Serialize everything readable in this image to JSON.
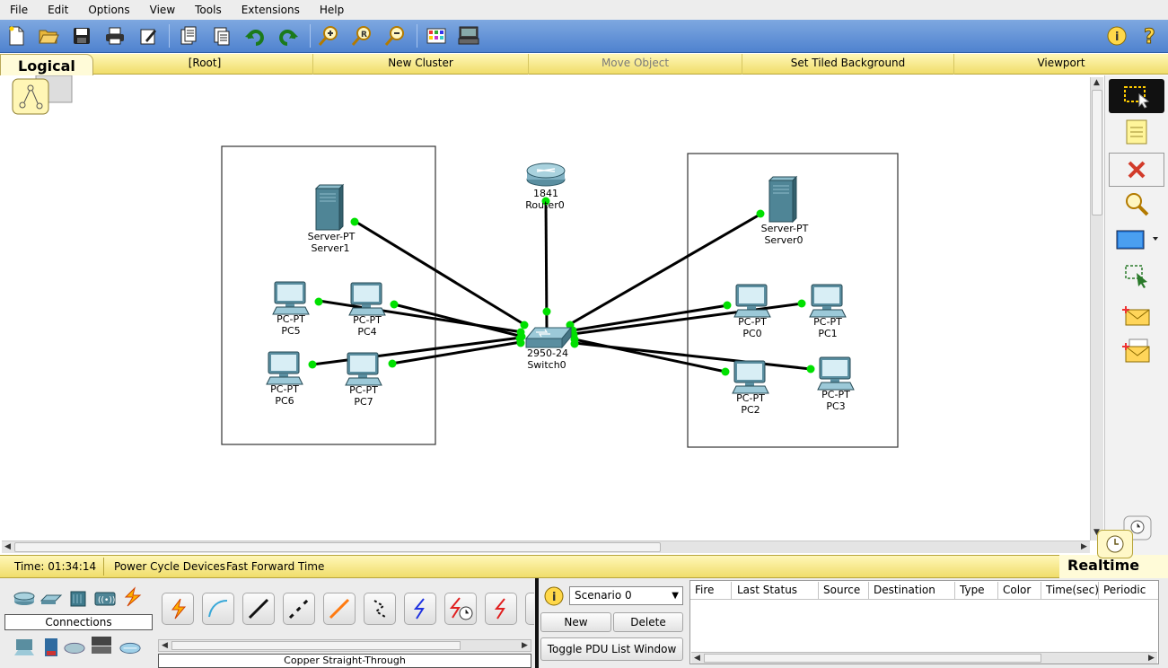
{
  "menu": [
    "File",
    "Edit",
    "Options",
    "View",
    "Tools",
    "Extensions",
    "Help"
  ],
  "toolbar_icons": [
    "new-icon",
    "open-icon",
    "save-icon",
    "print-icon",
    "activity-wizard-icon",
    "copy-icon",
    "paste-icon",
    "undo-icon",
    "redo-icon",
    "zoom-in-icon",
    "zoom-reset-icon",
    "zoom-out-icon",
    "palette-icon",
    "custom-device-icon",
    "info-icon",
    "help-icon"
  ],
  "logical_bar": {
    "tab_label": "Logical",
    "root": "[Root]",
    "new_cluster": "New Cluster",
    "move_object": "Move Object",
    "set_tiled_background": "Set Tiled Background",
    "viewport": "Viewport"
  },
  "devices": {
    "router0": {
      "model": "1841",
      "name": "Router0"
    },
    "switch0": {
      "model": "2950-24",
      "name": "Switch0"
    },
    "server1": {
      "model": "Server-PT",
      "name": "Server1"
    },
    "server0": {
      "model": "Server-PT",
      "name": "Server0"
    },
    "pc5": {
      "model": "PC-PT",
      "name": "PC5"
    },
    "pc4": {
      "model": "PC-PT",
      "name": "PC4"
    },
    "pc6": {
      "model": "PC-PT",
      "name": "PC6"
    },
    "pc7": {
      "model": "PC-PT",
      "name": "PC7"
    },
    "pc0": {
      "model": "PC-PT",
      "name": "PC0"
    },
    "pc1": {
      "model": "PC-PT",
      "name": "PC1"
    },
    "pc2": {
      "model": "PC-PT",
      "name": "PC2"
    },
    "pc3": {
      "model": "PC-PT",
      "name": "PC3"
    }
  },
  "link_color": "#000000",
  "link_status_color": "#00e000",
  "status": {
    "time": "Time: 01:34:14",
    "power_cycle": "Power Cycle Devices",
    "fast_forward": "Fast Forward Time",
    "realtime": "Realtime"
  },
  "device_panel": {
    "category_label": "Connections",
    "selected_connection": "Copper Straight-Through"
  },
  "scenario": {
    "selected": "Scenario 0",
    "new": "New",
    "delete": "Delete",
    "toggle_pdu": "Toggle PDU List Window"
  },
  "pdu_columns": [
    "Fire",
    "Last Status",
    "Source",
    "Destination",
    "Type",
    "Color",
    "Time(sec)",
    "Periodic"
  ]
}
